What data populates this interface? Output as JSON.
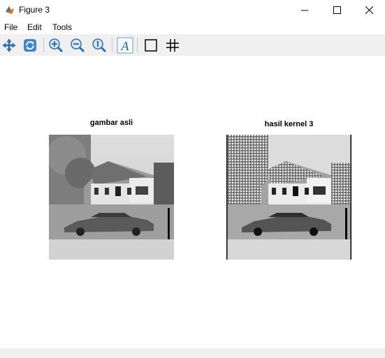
{
  "window": {
    "title": "Figure 3"
  },
  "menu": {
    "items": [
      "File",
      "Edit",
      "Tools"
    ]
  },
  "toolbar": {
    "buttons": [
      "pan-icon",
      "rotate-icon",
      "zoom-in-icon",
      "zoom-out-icon",
      "zoom-reset-icon",
      "insert-text-icon",
      "toggle-box-icon",
      "grid-icon"
    ]
  },
  "axes": [
    {
      "title": "gambar asli"
    },
    {
      "title": "hasil kernel 3"
    }
  ],
  "colors": {
    "toolbar_bg": "#f0f0f0",
    "figure_bg": "#ffffff"
  }
}
